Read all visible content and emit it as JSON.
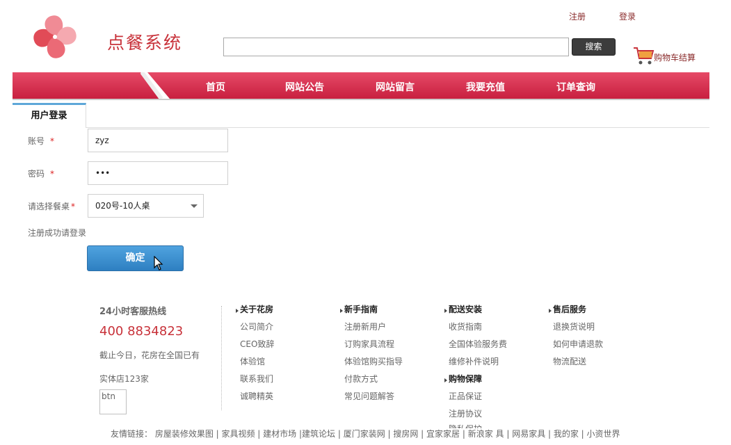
{
  "header": {
    "logo_text": "点餐系统",
    "register": "注册",
    "login": "登录",
    "search_value": "",
    "search_button": "搜索",
    "cart": "购物车结算"
  },
  "nav": {
    "items": [
      "首页",
      "网站公告",
      "网站留言",
      "我要充值",
      "订单查询"
    ]
  },
  "form": {
    "tab": "用户登录",
    "account_label": "账号",
    "account_value": "zyz",
    "password_label": "密码",
    "password_value": "•••",
    "table_label": "请选择餐桌",
    "table_value": "020号-10人桌",
    "required_mark": "*",
    "message": "注册成功请登录",
    "submit": "确定"
  },
  "footer": {
    "hotline_title": "24小时客服热线",
    "hotline_number": "400 8834823",
    "hotline_desc1": "截止今日，花房在全国已有",
    "hotline_desc2": "实体店123家",
    "btn_alt": "btn",
    "columns": [
      {
        "title": "关于花房",
        "links": [
          "公司简介",
          "CEO致辞",
          "体验馆",
          "联系我们",
          "诚聘精英"
        ]
      },
      {
        "title": "新手指南",
        "links": [
          "注册新用户",
          "订购家具流程",
          "体验馆购买指导",
          "付款方式",
          "常见问题解答"
        ]
      },
      {
        "title": "配送安装",
        "links": [
          "收货指南",
          "全国体验服务费",
          "维修补件说明"
        ]
      },
      {
        "title": "购物保障",
        "links": [
          "正品保证",
          "注册协议",
          "隐私保护"
        ]
      },
      {
        "title": "售后服务",
        "links": [
          "退换货说明",
          "如何申请退款",
          "物流配送"
        ]
      }
    ],
    "friend_links": "友情链接： 房屋装修效果图 | 家具视频 | 建材市场 |建筑论坛 | 厦门家装网 | 搜房网 | 宜家家居 | 新浪家 具 | 网易家具 | 我的家 | 小资世界"
  },
  "colors": {
    "brand_red": "#c8323a",
    "nav_red": "#d62d4d",
    "button_blue": "#3a8fd0"
  }
}
